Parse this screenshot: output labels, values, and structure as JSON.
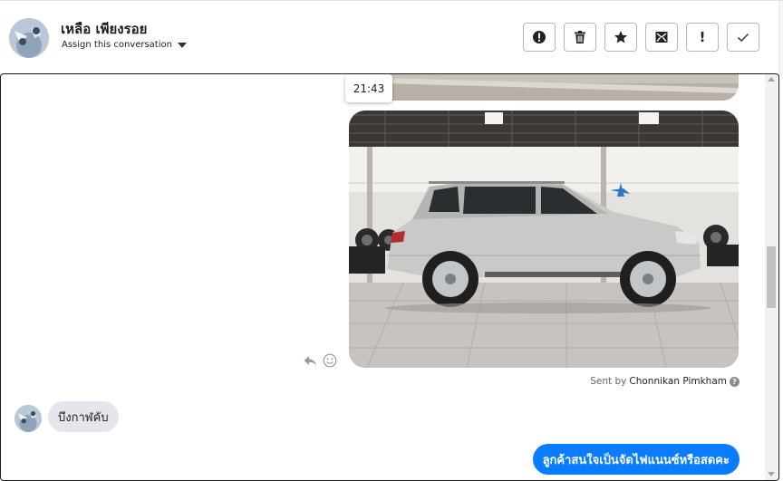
{
  "header": {
    "contact_name": "เหลือ เพียงรอย",
    "assign_label": "Assign this conversation",
    "actions": [
      {
        "name": "alert-icon",
        "label": "Mark as spam"
      },
      {
        "name": "trash-icon",
        "label": "Delete"
      },
      {
        "name": "star-icon",
        "label": "Star"
      },
      {
        "name": "mark-unread-icon",
        "label": "Mark as unread"
      },
      {
        "name": "exclamation-icon",
        "label": "!"
      },
      {
        "name": "check-icon",
        "label": "Done"
      }
    ]
  },
  "thread": {
    "timestamp": "21:43",
    "sent_by_prefix": "Sent by",
    "sent_by_name": "Chonnikan Pimkham",
    "help_glyph": "?",
    "incoming_message": "บึงกาฬคับ",
    "outgoing_message": "ลูกค้าสนใจเป็นจัดไฟแนนซ์หรือสดคะ"
  },
  "colors": {
    "accent": "#0a7cff",
    "incoming_bubble": "#e4e6eb"
  }
}
